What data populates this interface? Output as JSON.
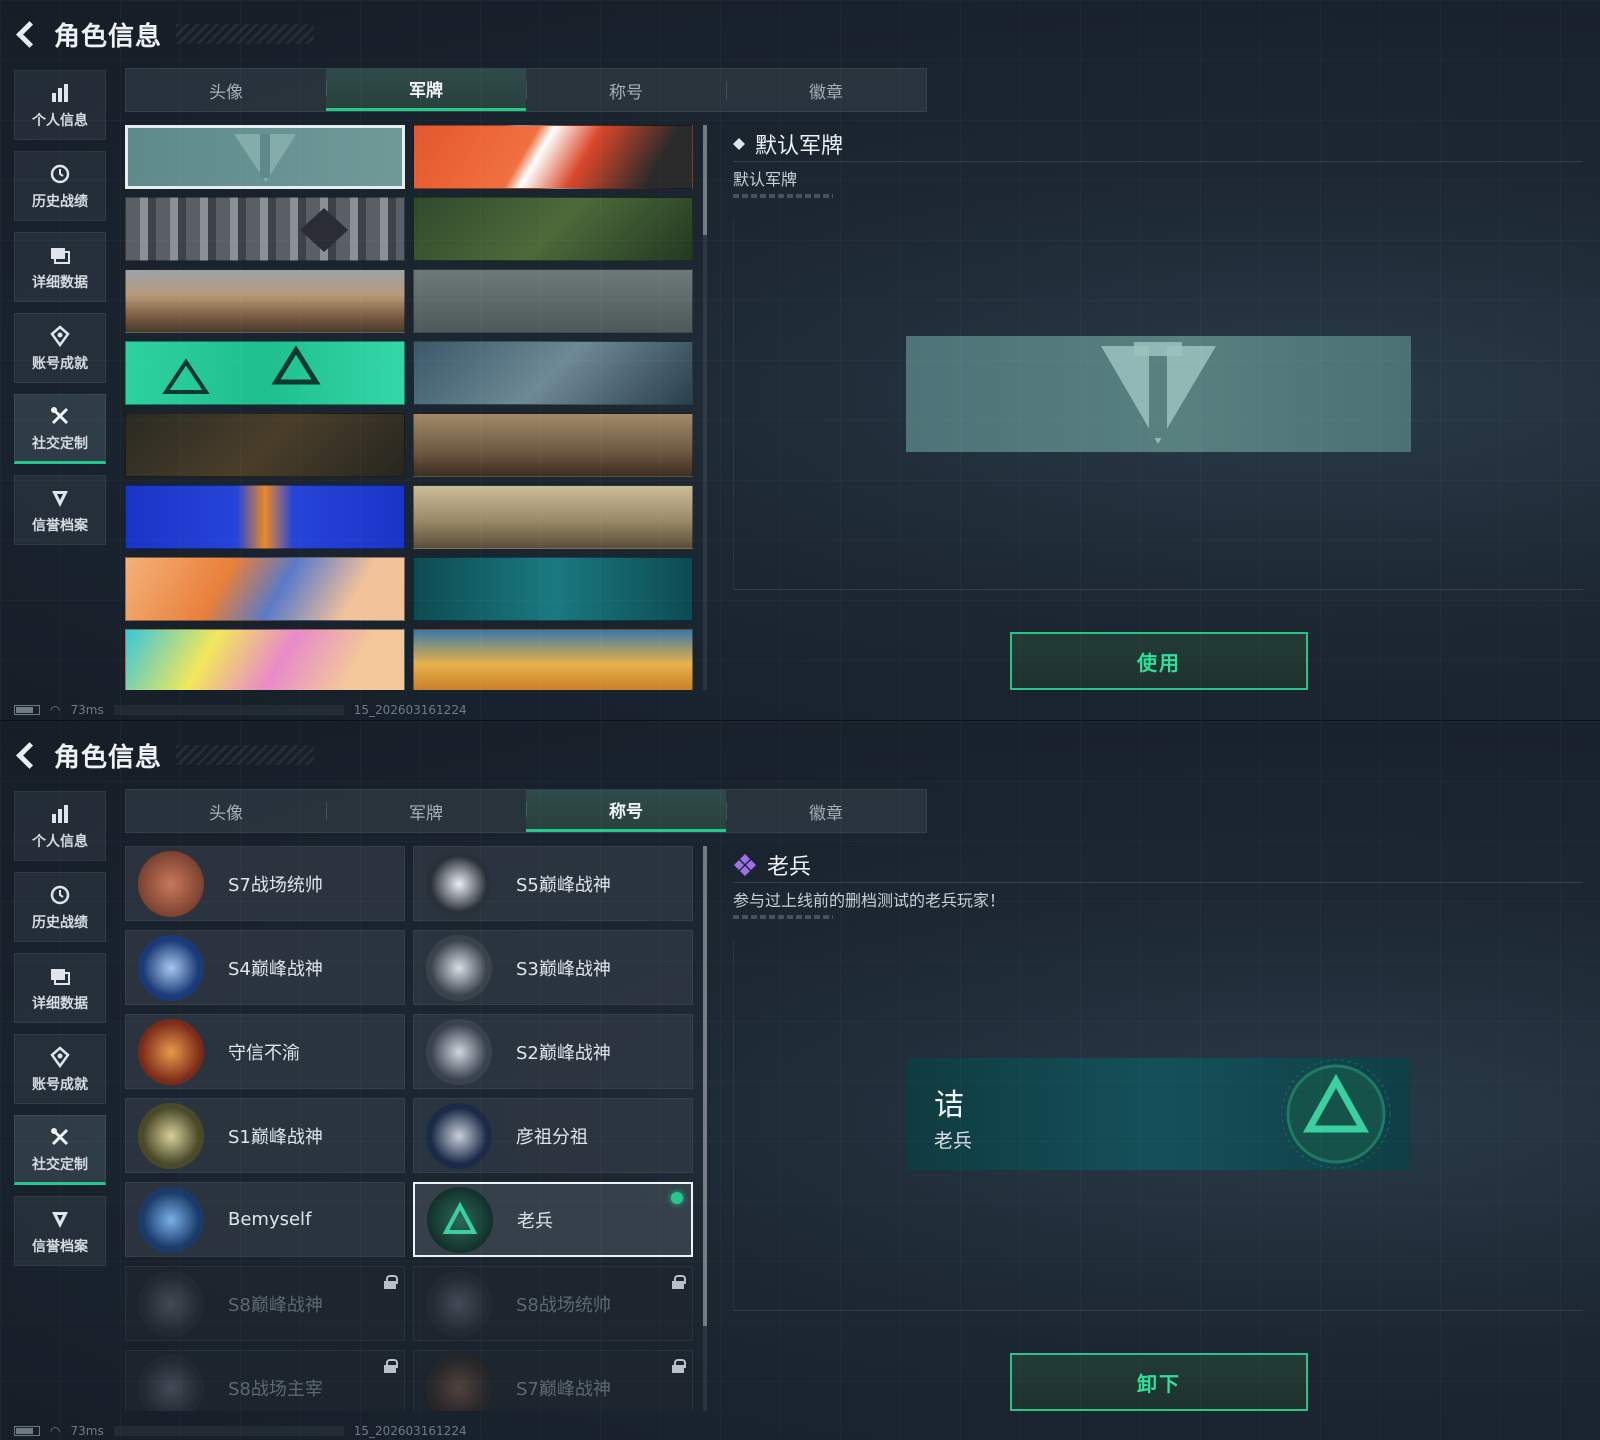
{
  "page_title": "角色信息",
  "sidebar": [
    {
      "label": "个人信息",
      "icon": "bar-chart-icon"
    },
    {
      "label": "历史战绩",
      "icon": "history-clock-icon"
    },
    {
      "label": "详细数据",
      "icon": "data-folder-icon"
    },
    {
      "label": "账号成就",
      "icon": "achievement-icon"
    },
    {
      "label": "社交定制",
      "icon": "tools-icon"
    },
    {
      "label": "信誉档案",
      "icon": "reputation-shield-icon"
    }
  ],
  "tabs": [
    "头像",
    "军牌",
    "称号",
    "徽章"
  ],
  "status": {
    "ping": "73ms",
    "build": "15_202603161224"
  },
  "screen1": {
    "active_tab": "军牌",
    "active_sidebar": "社交定制",
    "detail": {
      "title": "默认军牌",
      "description": "默认军牌"
    },
    "action_label": "使用"
  },
  "screen2": {
    "active_tab": "称号",
    "active_sidebar": "社交定制",
    "detail": {
      "title": "老兵",
      "description": "参与过上线前的删档测试的老兵玩家！"
    },
    "preview": {
      "main": "诘",
      "sub": "老兵"
    },
    "action_label": "卸下",
    "titles": [
      {
        "label": "S7战场统帅",
        "locked": false
      },
      {
        "label": "S5巅峰战神",
        "locked": false
      },
      {
        "label": "S4巅峰战神",
        "locked": false
      },
      {
        "label": "S3巅峰战神",
        "locked": false
      },
      {
        "label": "守信不渝",
        "locked": false
      },
      {
        "label": "S2巅峰战神",
        "locked": false
      },
      {
        "label": "S1巅峰战神",
        "locked": false
      },
      {
        "label": "彦祖分祖",
        "locked": false
      },
      {
        "label": "Bemyself",
        "locked": false
      },
      {
        "label": "老兵",
        "locked": false,
        "selected": true,
        "equipped": true
      },
      {
        "label": "S8巅峰战神",
        "locked": true
      },
      {
        "label": "S8战场统帅",
        "locked": true
      },
      {
        "label": "S8战场主宰",
        "locked": true
      },
      {
        "label": "S7巅峰战神",
        "locked": true
      }
    ]
  },
  "colors": {
    "accent": "#22c98a",
    "background": "#1c2732"
  }
}
